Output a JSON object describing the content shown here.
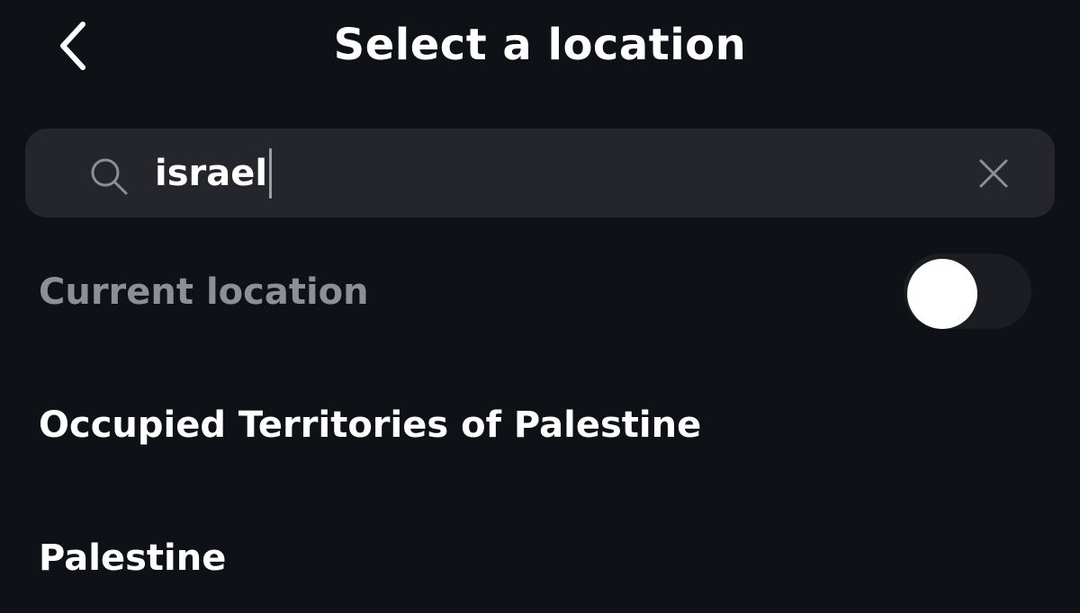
{
  "header": {
    "title": "Select a location",
    "back_icon": "chevron-left-icon"
  },
  "search": {
    "icon": "search-icon",
    "value": "israel",
    "clear_icon": "close-icon"
  },
  "current_location": {
    "label": "Current location",
    "toggle_on": false
  },
  "results": [
    {
      "label": "Occupied Territories of Palestine"
    },
    {
      "label": "Palestine"
    }
  ],
  "colors": {
    "background": "#0e1115",
    "search_bg": "#24262b",
    "muted_text": "#8c8f94",
    "text": "#ffffff"
  }
}
